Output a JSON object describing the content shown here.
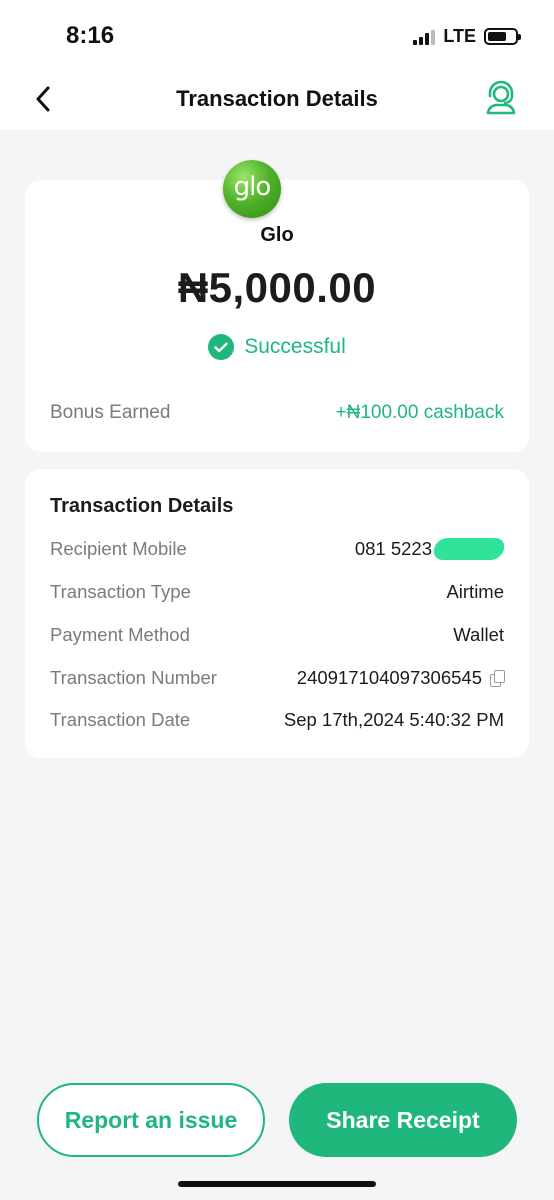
{
  "status_bar": {
    "time": "8:16",
    "network": "LTE"
  },
  "header": {
    "title": "Transaction Details",
    "back_icon": "chevron-left-icon",
    "support_icon": "customer-support-icon"
  },
  "summary": {
    "provider_logo_text": "glo",
    "provider": "Glo",
    "amount": "₦5,000.00",
    "status": "Successful",
    "bonus_label": "Bonus Earned",
    "bonus_value": "+₦100.00 cashback"
  },
  "details": {
    "heading": "Transaction Details",
    "rows": [
      {
        "label": "Recipient Mobile",
        "value": "081 5223"
      },
      {
        "label": "Transaction Type",
        "value": "Airtime"
      },
      {
        "label": "Payment Method",
        "value": "Wallet"
      },
      {
        "label": "Transaction Number",
        "value": "240917104097306545"
      },
      {
        "label": "Transaction Date",
        "value": "Sep 17th,2024 5:40:32 PM"
      }
    ]
  },
  "actions": {
    "report": "Report an issue",
    "share": "Share Receipt"
  },
  "colors": {
    "accent": "#1fb77c",
    "background": "#f5f5f7",
    "card": "#ffffff",
    "redaction": "#2fe39a"
  }
}
